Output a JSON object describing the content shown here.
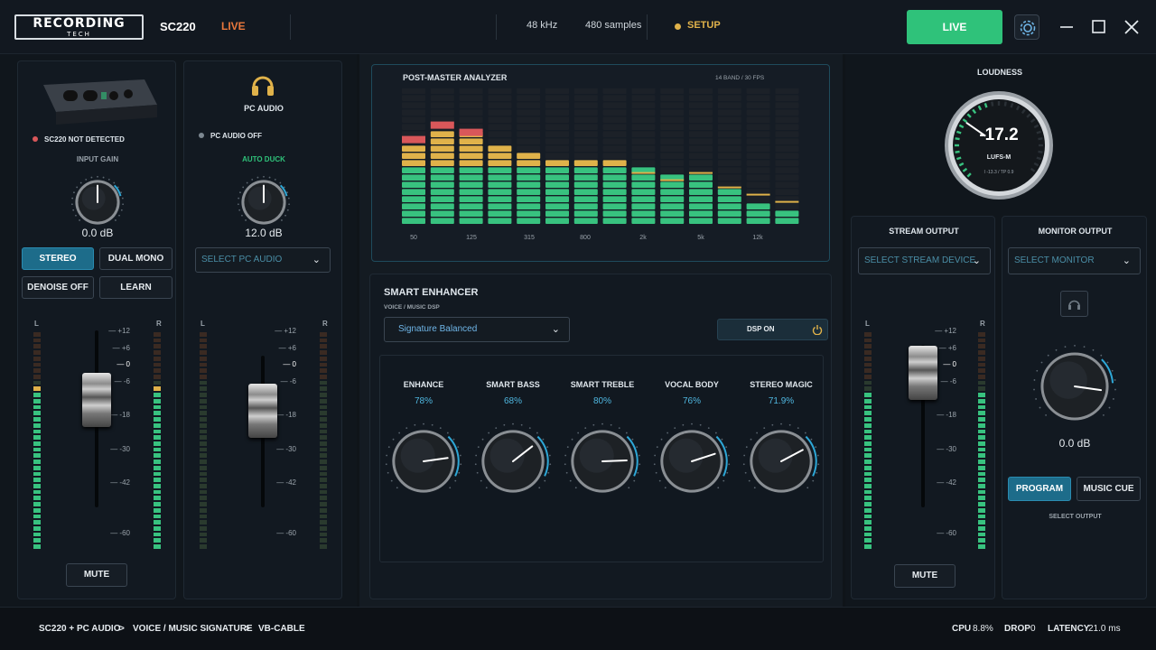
{
  "app": {
    "logo_main": "RECORDING",
    "logo_sub": "TECH",
    "device": "SC220",
    "mode": "LIVE",
    "sample_rate": "48 kHz",
    "buffer": "480 samples",
    "setup": "SETUP",
    "live_button": "LIVE"
  },
  "input_panel": {
    "status": "SC220 NOT DETECTED",
    "gain_label": "INPUT GAIN",
    "gain_value": "0.0 dB",
    "stereo": "STEREO",
    "dual_mono": "DUAL MONO",
    "denoise": "DENOISE OFF",
    "learn": "LEARN",
    "mute": "MUTE",
    "meter_l": "L",
    "meter_r": "R"
  },
  "pc_panel": {
    "title": "PC AUDIO",
    "status": "PC AUDIO OFF",
    "duck_label": "AUTO DUCK",
    "gain_value": "12.0 dB",
    "select": "SELECT PC AUDIO",
    "meter_l": "L",
    "meter_r": "R"
  },
  "fader_scale": [
    "+12",
    "+6",
    "0",
    "-6",
    "-18",
    "-30",
    "-42",
    "-60"
  ],
  "analyzer": {
    "title": "POST-MASTER ANALYZER",
    "info": "14 BAND  /  30 FPS",
    "freq_labels": [
      "50",
      "125",
      "315",
      "800",
      "2k",
      "5k",
      "12k"
    ],
    "band_levels": [
      11,
      13,
      13,
      11,
      10,
      9,
      9,
      9,
      8,
      7,
      7,
      5,
      3,
      2
    ],
    "band_peaks": [
      13,
      15,
      14,
      0,
      0,
      0,
      0,
      0,
      8,
      7,
      8,
      6,
      5,
      4
    ]
  },
  "enhancer": {
    "title": "SMART ENHANCER",
    "subtitle": "VOICE / MUSIC DSP",
    "preset": "Signature Balanced",
    "dsp": "DSP ON",
    "knobs": [
      {
        "label": "ENHANCE",
        "value": "78%"
      },
      {
        "label": "SMART BASS",
        "value": "68%"
      },
      {
        "label": "SMART TREBLE",
        "value": "80%"
      },
      {
        "label": "VOCAL BODY",
        "value": "76%"
      },
      {
        "label": "STEREO MAGIC",
        "value": "71.9%"
      }
    ]
  },
  "loudness": {
    "title": "LOUDNESS",
    "value": "-17.2",
    "unit": "LUFS-M",
    "detail": "I -13.3  /  TP 0.9"
  },
  "stream": {
    "title": "STREAM OUTPUT",
    "select": "SELECT STREAM DEVICE",
    "mute": "MUTE",
    "meter_l": "L",
    "meter_r": "R"
  },
  "monitor": {
    "title": "MONITOR OUTPUT",
    "select": "SELECT MONITOR",
    "value": "0.0 dB",
    "program": "PROGRAM",
    "music_cue": "MUSIC CUE",
    "select_output": "SELECT OUTPUT"
  },
  "status_bar": {
    "route1": "SC220 + PC AUDIO",
    "sep1": ">",
    "route2": "VOICE / MUSIC SIGNATURE",
    "sep2": ">",
    "route3": "VB-CABLE",
    "cpu_label": "CPU",
    "cpu": "8.8%",
    "drop_label": "DROP",
    "drop": "0",
    "latency_label": "LATENCY",
    "latency": "21.0 ms"
  },
  "colors": {
    "accent": "#2fc27a",
    "live_text": "#e8773c",
    "setup": "#e0b24a",
    "blue": "#1d6c8a",
    "meter_green": "#38c27f",
    "meter_yellow": "#e0b24a",
    "meter_red": "#d9575a"
  }
}
